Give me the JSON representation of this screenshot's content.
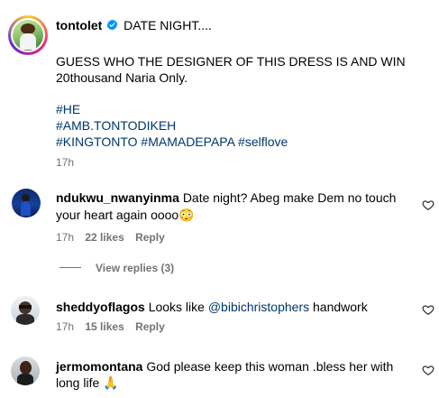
{
  "post": {
    "username": "tontolet",
    "verified": true,
    "caption_title": "DATE NIGHT....",
    "caption_line1": "GUESS WHO THE DESIGNER OF THIS DRESS IS AND WIN",
    "caption_line2": "20thousand Naria Only.",
    "hashtags": [
      "#HE",
      "#AMB.TONTODIKEH",
      "#KINGTONTO",
      "#MAMADEPAPA",
      "#selflove"
    ],
    "time": "17h"
  },
  "comments": [
    {
      "username": "ndukwu_nwanyinma",
      "text_line1": "Date night? Abeg make Dem no touch",
      "text_line2": "your heart again oooo",
      "emoji": "😳",
      "time": "17h",
      "likes": "22 likes",
      "reply": "Reply",
      "view_replies": "View replies (3)"
    },
    {
      "username": "sheddyoflagos",
      "text_pre": "Looks like",
      "mention": "@bibichristophers",
      "text_post": "handwork",
      "time": "17h",
      "likes": "15 likes",
      "reply": "Reply"
    },
    {
      "username": "jermomontana",
      "text_line1": "God please keep this woman .bless her with",
      "text_line2": "long life",
      "emoji": "🙏"
    }
  ],
  "icons": {
    "verified": "verified-badge-icon",
    "like": "heart-icon"
  },
  "colors": {
    "link": "#00376b",
    "verified": "#0095f6",
    "meta": "#737373"
  }
}
